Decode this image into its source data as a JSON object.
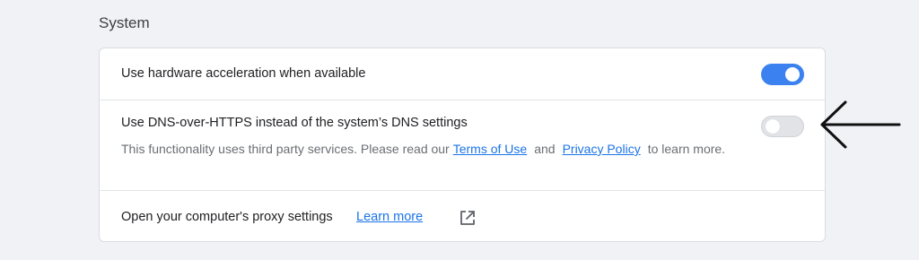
{
  "section": {
    "title": "System"
  },
  "settings": {
    "hardware_acceleration": {
      "label": "Use hardware acceleration when available",
      "enabled": true
    },
    "dns_over_https": {
      "label": "Use DNS-over-HTTPS instead of the system’s DNS settings",
      "enabled": false,
      "description_prefix": "This functionality uses third party services. Please read our",
      "terms_link": "Terms of Use",
      "and_text": "and",
      "privacy_link": "Privacy Policy",
      "description_suffix": "to learn more."
    },
    "proxy": {
      "label": "Open your computer's proxy settings",
      "learn_more": "Learn more",
      "icon": "external-link-icon"
    }
  },
  "annotation": {
    "icon": "left-arrow-icon"
  },
  "colors": {
    "toggle_on": "#3b82f0",
    "toggle_off": "#e1e3e6",
    "link": "#1a73e8"
  }
}
